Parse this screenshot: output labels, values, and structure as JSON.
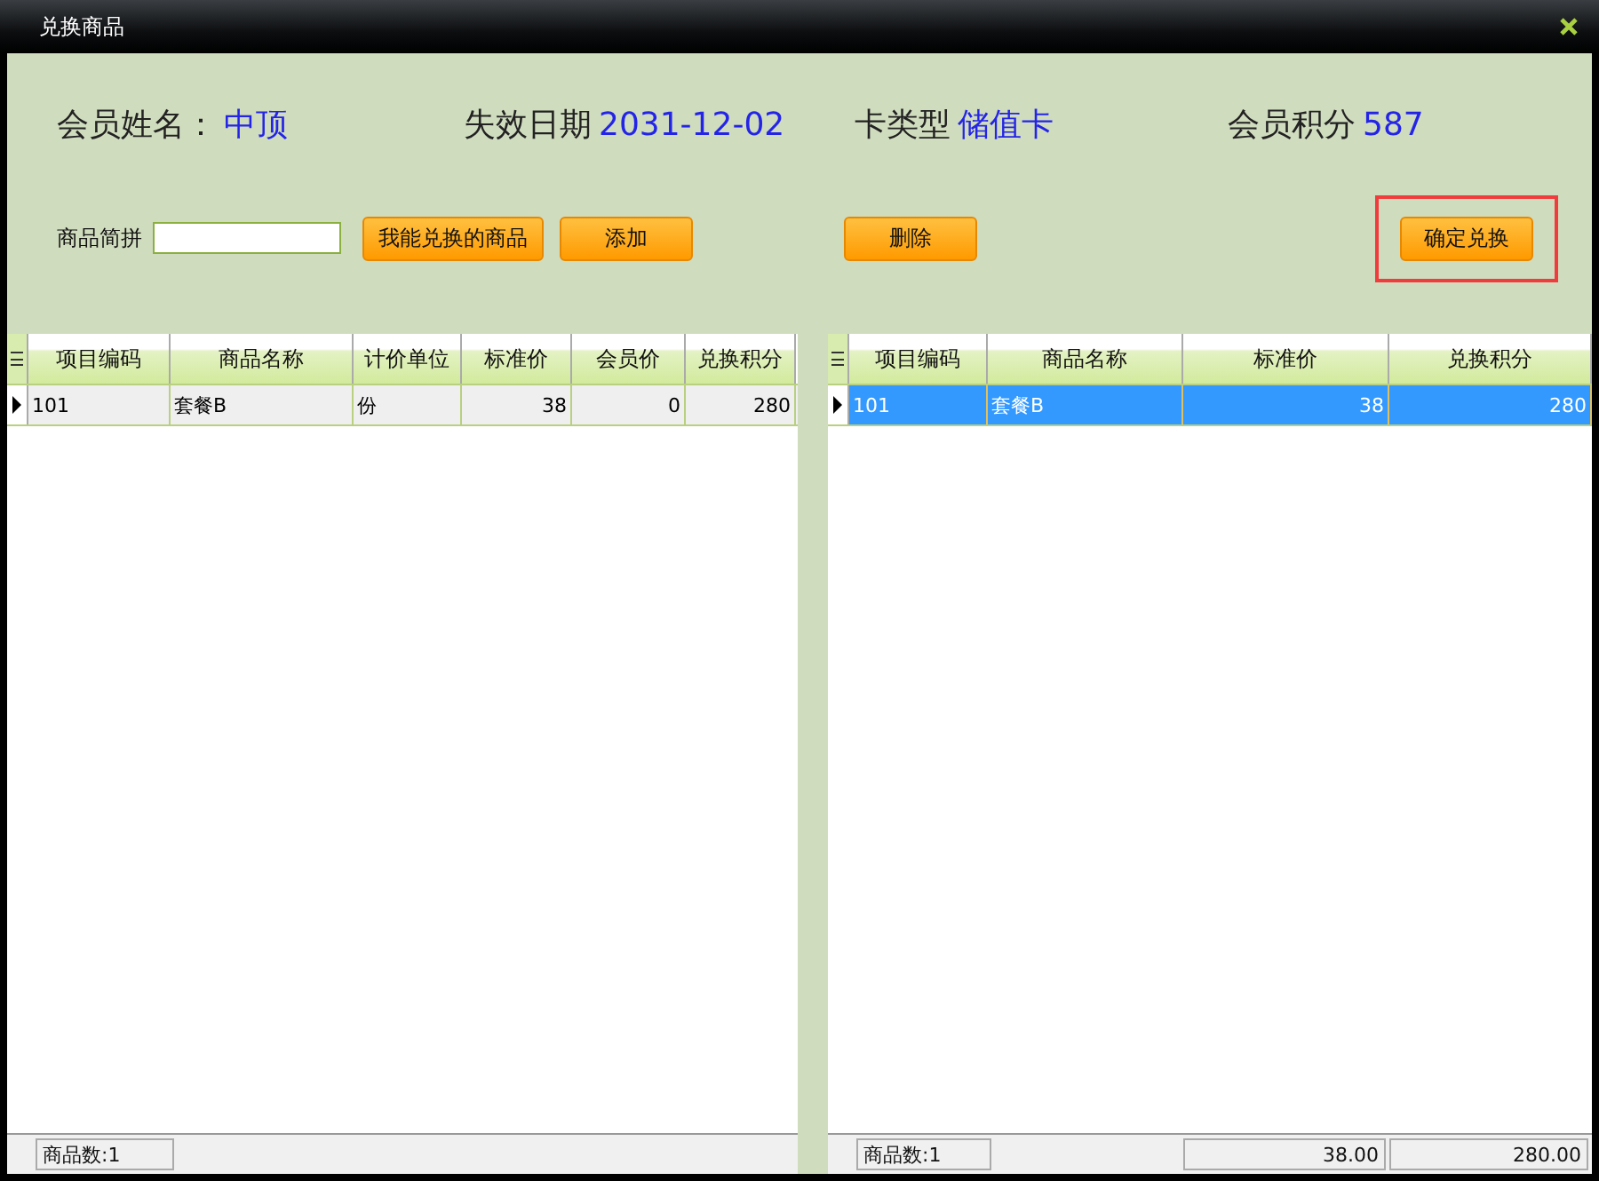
{
  "window": {
    "title": "兑换商品"
  },
  "member_info": [
    {
      "label": "会员姓名：",
      "value": "中顶"
    },
    {
      "label": "失效日期",
      "value": "2031-12-02"
    },
    {
      "label": "卡类型",
      "value": "储值卡"
    },
    {
      "label": "会员积分",
      "value": "587"
    }
  ],
  "search": {
    "label": "商品简拼"
  },
  "left_buttons": [
    {
      "label": "我能兑换的商品",
      "highlighted": false
    },
    {
      "label": "添加",
      "highlighted": false
    }
  ],
  "right_buttons": [
    {
      "label": "删除",
      "highlighted": false
    },
    {
      "label": "确定兑换",
      "highlighted": true
    }
  ],
  "available_table": {
    "columns": [
      "项目编码",
      "商品名称",
      "计价单位",
      "标准价",
      "会员价",
      "兑换积分"
    ],
    "rows": [
      {
        "current": true,
        "selected": false,
        "cells": [
          "101",
          "套餐B",
          "份",
          "38",
          "0",
          "280"
        ]
      }
    ],
    "footer": [
      "商品数:1"
    ]
  },
  "exchange_table": {
    "columns": [
      "项目编码",
      "商品名称",
      "标准价",
      "兑换积分"
    ],
    "rows": [
      {
        "current": true,
        "selected": true,
        "cells": [
          "101",
          "套餐B",
          "38",
          "280"
        ]
      }
    ],
    "footer": [
      "商品数:1",
      "38.00",
      "280.00"
    ]
  }
}
